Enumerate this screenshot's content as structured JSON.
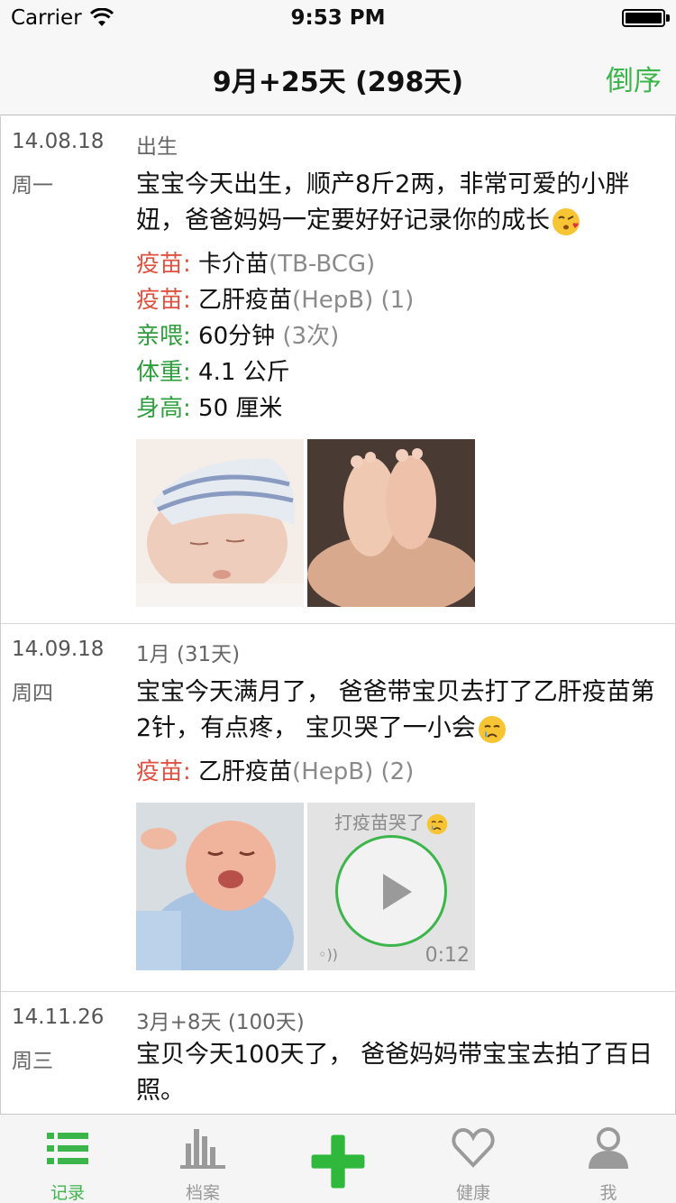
{
  "status_bar": {
    "carrier": "Carrier",
    "time": "9:53 PM"
  },
  "nav": {
    "title": "9月+25天 (298天)",
    "action": "倒序"
  },
  "entries": [
    {
      "date": "14.08.18",
      "weekday": "周一",
      "age": "出生",
      "text": "宝宝今天出生，顺产8斤2两，非常可爱的小胖妞，爸爸妈妈一定要好好记录你的成长",
      "emoji": "kissing-face-emoji",
      "records": [
        {
          "label": "疫苗:",
          "value": "卡介苗",
          "extra": "(TB-BCG)",
          "color": "#e05040"
        },
        {
          "label": "疫苗:",
          "value": "乙肝疫苗",
          "extra": "(HepB) (1)",
          "color": "#e05040"
        },
        {
          "label": "亲喂:",
          "value": "60分钟",
          "extra": "(3次)",
          "color": "#2e9e3c"
        },
        {
          "label": "体重:",
          "value": "4.1 公斤",
          "extra": "",
          "color": "#2e9e3c"
        },
        {
          "label": "身高:",
          "value": "50 厘米",
          "extra": "",
          "color": "#2e9e3c"
        }
      ],
      "photos": [
        "sleeping-newborn-photo",
        "baby-feet-in-hands-photo"
      ]
    },
    {
      "date": "14.09.18",
      "weekday": "周四",
      "age": "1月 (31天)",
      "text": "宝宝今天满月了， 爸爸带宝贝去打了乙肝疫苗第2针，有点疼， 宝贝哭了一小会",
      "emoji": "crying-face-emoji",
      "records": [
        {
          "label": "疫苗:",
          "value": "乙肝疫苗",
          "extra": "(HepB) (2)",
          "color": "#e05040"
        }
      ],
      "photos": [
        "crying-baby-photo"
      ],
      "audio": {
        "title": "打疫苗哭了",
        "duration": "0:12"
      }
    },
    {
      "date": "14.11.26",
      "weekday": "周三",
      "age": "3月+8天 (100天)",
      "text": "宝贝今天100天了， 爸爸妈妈带宝宝去拍了百日照。"
    }
  ],
  "tabs": [
    {
      "label": "记录",
      "icon": "list-icon",
      "active": true
    },
    {
      "label": "档案",
      "icon": "chart-bars-icon",
      "active": false
    },
    {
      "label": "",
      "icon": "plus-icon",
      "active": false
    },
    {
      "label": "健康",
      "icon": "heart-icon",
      "active": false
    },
    {
      "label": "我",
      "icon": "profile-icon",
      "active": false
    }
  ],
  "colors": {
    "accent": "#3cb54a",
    "vaccine": "#e05040",
    "growth": "#2e9e3c"
  }
}
